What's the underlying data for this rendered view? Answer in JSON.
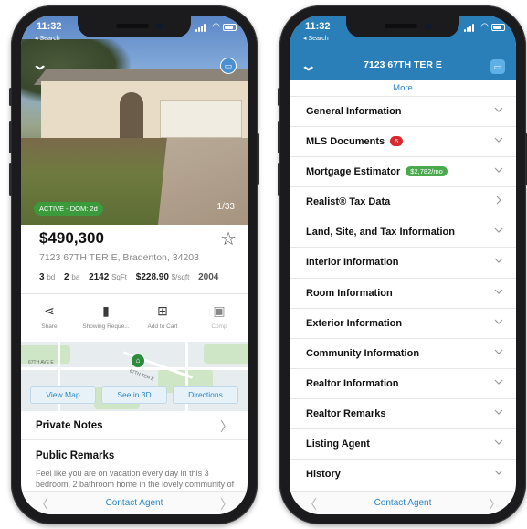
{
  "left": {
    "status": {
      "time": "11:32",
      "back_app": "Search"
    },
    "photo": {
      "status_badge": "ACTIVE - DOM: 2d",
      "counter": "1/33"
    },
    "listing": {
      "price": "$490,300",
      "address": "7123 67TH TER E, Bradenton, 34203",
      "beds": "3",
      "beds_unit": "bd",
      "baths": "2",
      "baths_unit": "ba",
      "sqft": "2142",
      "sqft_unit": "SqFt",
      "price_per_sqft": "$228.90",
      "pps_unit": "$/sqft",
      "year": "2004"
    },
    "actions": [
      {
        "label": "Share",
        "icon": "share-icon"
      },
      {
        "label": "Showing Reque...",
        "icon": "door-icon"
      },
      {
        "label": "Add to Cart",
        "icon": "cart-icon"
      },
      {
        "label": "Comp",
        "icon": "compare-icon"
      }
    ],
    "map": {
      "streets": [
        "67TH AVE E",
        "67TH TER E"
      ],
      "buttons": [
        "View Map",
        "See in 3D",
        "Directions"
      ]
    },
    "private_notes": "Private Notes",
    "public_remarks_title": "Public Remarks",
    "public_remarks_text": "Feel like you are on vacation every day in this 3 bedroom, 2 bathroom home in the lovely community of River Place. This home is well-",
    "contact": "Contact Agent"
  },
  "right": {
    "status": {
      "time": "11:32",
      "back_app": "Search"
    },
    "header_title": "7123 67TH TER E",
    "more_label": "More",
    "sections": [
      {
        "label": "General Information",
        "icon": "chevron-down-icon"
      },
      {
        "label": "MLS Documents",
        "badge": "5",
        "badge_color": "#d9282e",
        "icon": "chevron-down-icon"
      },
      {
        "label": "Mortgage Estimator",
        "badge": "$2,782/mo",
        "badge_color": "#4aa94d",
        "icon": "chevron-down-icon"
      },
      {
        "label": "Realist® Tax Data",
        "icon": "chevron-right-icon"
      },
      {
        "label": "Land, Site, and Tax Information",
        "icon": "chevron-down-icon"
      },
      {
        "label": "Interior Information",
        "icon": "chevron-down-icon"
      },
      {
        "label": "Room Information",
        "icon": "chevron-down-icon"
      },
      {
        "label": "Exterior Information",
        "icon": "chevron-down-icon"
      },
      {
        "label": "Community Information",
        "icon": "chevron-down-icon"
      },
      {
        "label": "Realtor Information",
        "icon": "chevron-down-icon"
      },
      {
        "label": "Realtor Remarks",
        "icon": "chevron-down-icon"
      },
      {
        "label": "Listing Agent",
        "icon": "chevron-down-icon"
      },
      {
        "label": "History",
        "icon": "chevron-down-icon"
      }
    ],
    "contact": "Contact Agent"
  },
  "colors": {
    "brand_blue": "#2a7fb8",
    "link_blue": "#2b86c5",
    "active_green": "#3b9a3c"
  }
}
